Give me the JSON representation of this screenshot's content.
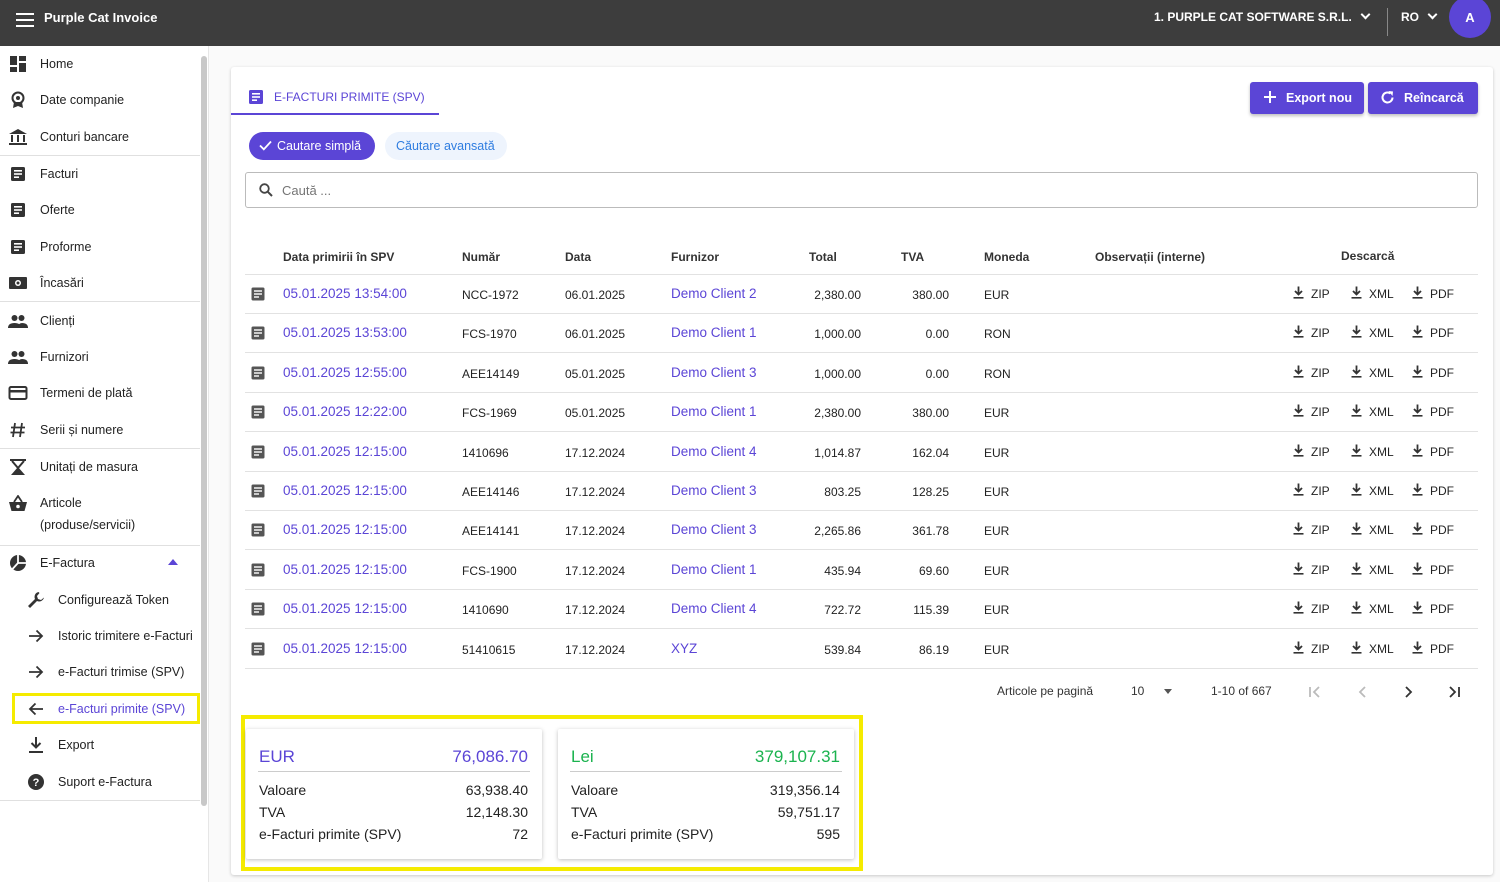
{
  "app": {
    "title": "Purple Cat Invoice",
    "company": "1. PURPLE CAT SOFTWARE S.R.L.",
    "lang": "RO",
    "avatar": "A"
  },
  "sidebar": {
    "items": [
      {
        "label": "Home",
        "icon": "dashboard-icon"
      },
      {
        "label": "Date companie",
        "icon": "badge-icon"
      },
      {
        "label": "Conturi bancare",
        "icon": "bank-icon"
      },
      {
        "label": "Facturi",
        "icon": "document-icon"
      },
      {
        "label": "Oferte",
        "icon": "document-icon"
      },
      {
        "label": "Proforme",
        "icon": "document-icon"
      },
      {
        "label": "Încasări",
        "icon": "cash-icon"
      },
      {
        "label": "Clienți",
        "icon": "people-icon"
      },
      {
        "label": "Furnizori",
        "icon": "people-icon"
      },
      {
        "label": "Termeni de plată",
        "icon": "credit-card-icon"
      },
      {
        "label": "Serii și numere",
        "icon": "hash-icon"
      },
      {
        "label": "Unitați de masura",
        "icon": "scale-icon"
      },
      {
        "label": "Articole",
        "label2": "(produse/servicii)",
        "icon": "basket-icon"
      },
      {
        "label": "E-Factura",
        "icon": "pie-chart-icon"
      }
    ],
    "sub": [
      {
        "label": "Configurează Token",
        "icon": "wrench-icon"
      },
      {
        "label": "Istoric trimitere e-Facturi",
        "icon": "arrow-right-icon"
      },
      {
        "label": "e-Facturi trimise (SPV)",
        "icon": "arrow-right-icon"
      },
      {
        "label": "e-Facturi primite (SPV)",
        "icon": "arrow-left-icon"
      },
      {
        "label": "Export",
        "icon": "download-icon"
      },
      {
        "label": "Suport e-Factura",
        "icon": "help-icon"
      }
    ]
  },
  "main": {
    "tab": "E-FACTURI PRIMITE (SPV)",
    "export_btn": "Export nou",
    "reload_btn": "Reîncarcă",
    "chip_simple": "Cautare simplă",
    "chip_advanced": "Căutare avansată",
    "search_placeholder": "Caută ..."
  },
  "table": {
    "headers": [
      "Data primirii în SPV",
      "Număr",
      "Data",
      "Furnizor",
      "Total",
      "TVA",
      "Moneda",
      "Observații (interne)",
      "Descarcă"
    ],
    "dl": [
      "ZIP",
      "XML",
      "PDF"
    ],
    "rows": [
      {
        "received": "05.01.2025 13:54:00",
        "number": "NCC-1972",
        "date": "06.01.2025",
        "supplier": "Demo Client 2",
        "total": "2,380.00",
        "vat": "380.00",
        "currency": "EUR"
      },
      {
        "received": "05.01.2025 13:53:00",
        "number": "FCS-1970",
        "date": "06.01.2025",
        "supplier": "Demo Client 1",
        "total": "1,000.00",
        "vat": "0.00",
        "currency": "RON"
      },
      {
        "received": "05.01.2025 12:55:00",
        "number": "AEE14149",
        "date": "05.01.2025",
        "supplier": "Demo Client 3",
        "total": "1,000.00",
        "vat": "0.00",
        "currency": "RON"
      },
      {
        "received": "05.01.2025 12:22:00",
        "number": "FCS-1969",
        "date": "05.01.2025",
        "supplier": "Demo Client 1",
        "total": "2,380.00",
        "vat": "380.00",
        "currency": "EUR"
      },
      {
        "received": "05.01.2025 12:15:00",
        "number": "1410696",
        "date": "17.12.2024",
        "supplier": "Demo Client 4",
        "total": "1,014.87",
        "vat": "162.04",
        "currency": "EUR"
      },
      {
        "received": "05.01.2025 12:15:00",
        "number": "AEE14146",
        "date": "17.12.2024",
        "supplier": "Demo Client 3",
        "total": "803.25",
        "vat": "128.25",
        "currency": "EUR"
      },
      {
        "received": "05.01.2025 12:15:00",
        "number": "AEE14141",
        "date": "17.12.2024",
        "supplier": "Demo Client 3",
        "total": "2,265.86",
        "vat": "361.78",
        "currency": "EUR"
      },
      {
        "received": "05.01.2025 12:15:00",
        "number": "FCS-1900",
        "date": "17.12.2024",
        "supplier": "Demo Client 1",
        "total": "435.94",
        "vat": "69.60",
        "currency": "EUR"
      },
      {
        "received": "05.01.2025 12:15:00",
        "number": "1410690",
        "date": "17.12.2024",
        "supplier": "Demo Client 4",
        "total": "722.72",
        "vat": "115.39",
        "currency": "EUR"
      },
      {
        "received": "05.01.2025 12:15:00",
        "number": "51410615",
        "date": "17.12.2024",
        "supplier": "XYZ",
        "total": "539.84",
        "vat": "86.19",
        "currency": "EUR"
      }
    ]
  },
  "pagination": {
    "label": "Articole pe pagină",
    "page_size": "10",
    "range": "1-10 of 667"
  },
  "summary": [
    {
      "currency": "EUR",
      "total": "76,086.70",
      "color": "#5b45d6",
      "labels": [
        "Valoare",
        "TVA",
        "e-Facturi primite (SPV)"
      ],
      "values": [
        "63,938.40",
        "12,148.30",
        "72"
      ]
    },
    {
      "currency": "Lei",
      "total": "379,107.31",
      "color": "#1bb34f",
      "labels": [
        "Valoare",
        "TVA",
        "e-Facturi primite (SPV)"
      ],
      "values": [
        "319,356.14",
        "59,751.17",
        "595"
      ]
    }
  ],
  "colors": {
    "accent": "#5b45d6",
    "topbar": "#3d3d3d",
    "highlight": "#f5eb00",
    "green": "#1bb34f"
  }
}
